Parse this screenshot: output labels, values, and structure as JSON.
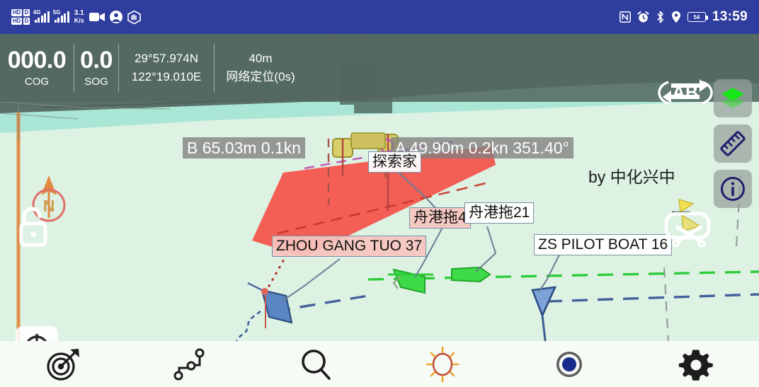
{
  "statusbar": {
    "icons": [
      "hd-badge-icon",
      "hd-badge-icon",
      "signal-4g-icon",
      "signal-5g-icon",
      "data-rate-icon",
      "video-camera-icon",
      "user-account-icon",
      "palm-gesture-icon"
    ],
    "hd_label_1": "HD",
    "hd_label_2": "HD",
    "hd_sub_1": "D",
    "hd_sub_2": "D",
    "signal_label_1": "4G",
    "signal_label_2": "5G",
    "data_rate": "3.1",
    "data_rate_unit": "K/s",
    "right_icons": [
      "nfc-icon",
      "alarm-clock-icon",
      "bluetooth-icon",
      "location-pin-icon",
      "battery-icon"
    ],
    "battery_level": "54",
    "time": "13:59"
  },
  "infobar": {
    "cog_value": "000.0",
    "cog_label": "COG",
    "sog_value": "0.0",
    "sog_label": "SOG",
    "latitude": "29°57.974N",
    "longitude": "122°19.010E",
    "altitude": "40m",
    "fix_source": "网络定位(0s)"
  },
  "map": {
    "ais_b": "B 65.03m 0.1kn",
    "ais_a": "A 49.90m 0.2kn 351.40°",
    "attribution": "by 中化兴中",
    "vessel_labels": [
      {
        "name": "探索家",
        "style": "white"
      },
      {
        "name": "舟港拖4",
        "style": "pink"
      },
      {
        "name": "舟港拖21",
        "style": "white"
      },
      {
        "name": "ZHOU GANG TUO 37",
        "style": "pink"
      },
      {
        "name": "ZS PILOT BOAT 16",
        "style": "white"
      }
    ],
    "colors": {
      "sea_far": "#a9e6d6",
      "sea_near": "#ddf2e2",
      "land": "#546861",
      "danger_zone": "#f4534a",
      "vessel_green": "#3ddb47",
      "vessel_blue": "#5a86c4",
      "vessel_yellow": "#d9cf6a",
      "route_orange": "#e08a42",
      "accent_blue": "#2f3d9e"
    }
  },
  "right_buttons": [
    {
      "name": "layers-button",
      "icon": "layers-icon"
    },
    {
      "name": "measure-button",
      "icon": "ruler-icon"
    },
    {
      "name": "info-button",
      "icon": "info-circle-icon"
    }
  ],
  "ab_button": {
    "label": "AB",
    "icon": "ab-loop-icon"
  },
  "left_widgets": {
    "compass_label": "N",
    "compass_icon": "compass-north-icon",
    "lock_icon": "padlock-unlocked-icon",
    "locate_icon": "crosshair-locate-icon"
  },
  "toolbar": [
    {
      "name": "target-button",
      "icon": "target-arrow-icon"
    },
    {
      "name": "route-button",
      "icon": "route-waypoints-icon"
    },
    {
      "name": "search-button",
      "icon": "search-icon"
    },
    {
      "name": "brightness-button",
      "icon": "sun-brightness-icon"
    },
    {
      "name": "record-button",
      "icon": "record-circle-icon"
    },
    {
      "name": "settings-button",
      "icon": "gear-icon"
    }
  ]
}
